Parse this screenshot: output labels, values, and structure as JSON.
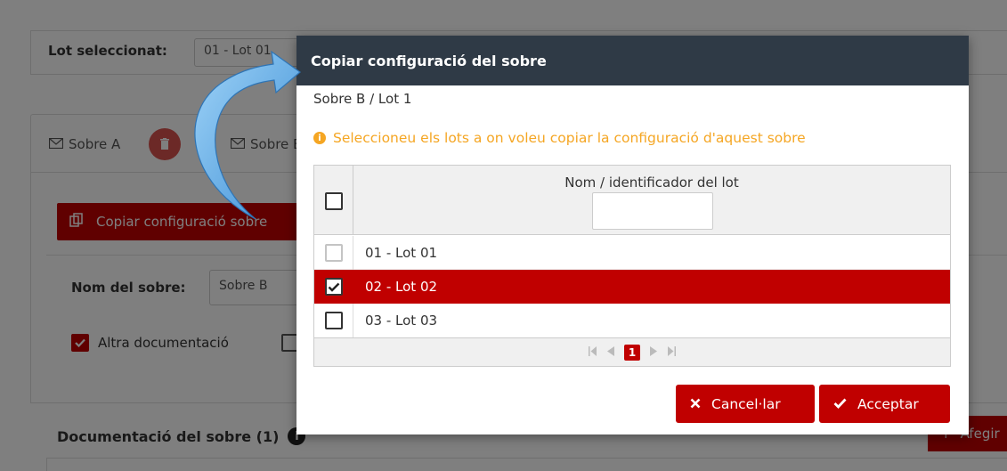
{
  "background": {
    "lot_label": "Lot seleccionat:",
    "lot_value": "01 - Lot 01",
    "tabs": [
      {
        "label": "Sobre A"
      },
      {
        "label": "Sobre B"
      }
    ],
    "copy_button_label": "Copiar configuració sobre",
    "nom_label": "Nom del sobre:",
    "nom_value": "Sobre B",
    "altra_label": "Altra documentació",
    "doc_label": "Documentació del sobre (1)",
    "afegir_label": "Afegir"
  },
  "modal": {
    "title": "Copiar configuració del sobre",
    "subtitle": "Sobre B / Lot 1",
    "warning": "Seleccioneu els lots a on voleu copiar la configuració d'aquest sobre",
    "grid": {
      "column_header": "Nom / identificador del lot",
      "filter_value": "",
      "rows": [
        {
          "label": "01 - Lot 01",
          "checked": false,
          "disabled": true
        },
        {
          "label": "02 - Lot 02",
          "checked": true,
          "disabled": false
        },
        {
          "label": "03 - Lot 03",
          "checked": false,
          "disabled": false
        }
      ],
      "pager": {
        "current_page": "1"
      }
    },
    "cancel_label": "Cancel·lar",
    "accept_label": "Acceptar"
  },
  "colors": {
    "accent": "#c00000",
    "header": "#2f3a46",
    "warning": "#f5a623"
  }
}
